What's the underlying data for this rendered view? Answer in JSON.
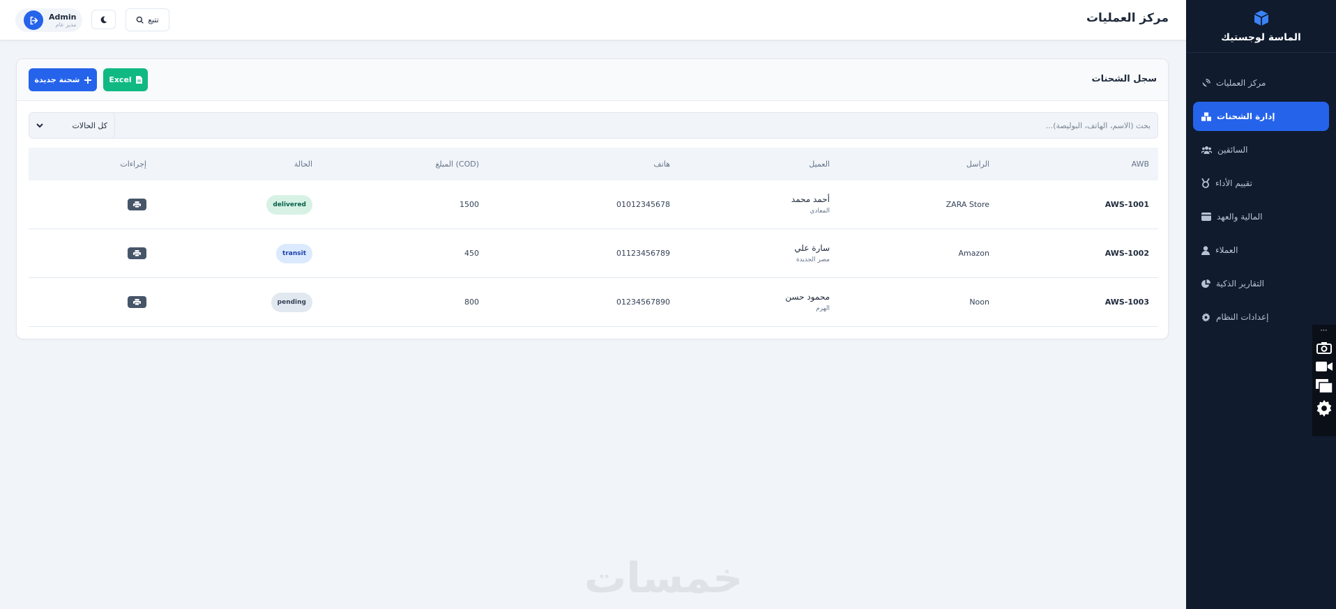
{
  "brand": {
    "name": "الماسة لوجستيك",
    "logo_icon": "cube-icon",
    "accent": "#2563eb"
  },
  "sidebar": {
    "items": [
      {
        "label": "مركز العمليات",
        "icon": "satellite-dish-icon",
        "active": false
      },
      {
        "label": "إدارة الشحنات",
        "icon": "boxes-icon",
        "active": true
      },
      {
        "label": "السائقين",
        "icon": "users-icon",
        "active": false
      },
      {
        "label": "تقييم الأداء",
        "icon": "medal-icon",
        "active": false
      },
      {
        "label": "المالية والعهد",
        "icon": "wallet-icon",
        "active": false
      },
      {
        "label": "العملاء",
        "icon": "user-icon",
        "active": false
      },
      {
        "label": "التقارير الذكية",
        "icon": "pie-chart-icon",
        "active": false
      },
      {
        "label": "إعدادات النظام",
        "icon": "gear-icon",
        "active": false
      }
    ]
  },
  "header": {
    "title": "مركز العمليات",
    "track_label": "تتبع",
    "user": {
      "name": "Admin",
      "role": "مدير عام"
    }
  },
  "card": {
    "title": "سجل الشحنات",
    "new_shipment_label": "شحنة جديدة",
    "excel_label": "Excel",
    "search_placeholder": "بحث (الاسم، الهاتف، البوليصة)...",
    "status_filter": "كل الحالات"
  },
  "table": {
    "headers": {
      "awb": "AWB",
      "sender": "الراسل",
      "client": "العميل",
      "phone": "هاتف",
      "amount": "المبلغ (COD)",
      "status": "الحالة",
      "actions": "إجراءات"
    },
    "rows": [
      {
        "awb": "AWS-1001",
        "sender": "ZARA Store",
        "client_name": "أحمد محمد",
        "client_area": "المعادي",
        "phone": "01012345678",
        "amount": "1500",
        "status": "delivered"
      },
      {
        "awb": "AWS-1002",
        "sender": "Amazon",
        "client_name": "سارة علي",
        "client_area": "مصر الجديدة",
        "phone": "01123456789",
        "amount": "450",
        "status": "transit"
      },
      {
        "awb": "AWS-1003",
        "sender": "Noon",
        "client_name": "محمود حسن",
        "client_area": "الهرم",
        "phone": "01234567890",
        "amount": "800",
        "status": "pending"
      }
    ]
  },
  "status_colors": {
    "delivered": "#d7f2e5",
    "transit": "#dbeafe",
    "pending": "#e2e8f0"
  },
  "watermark": "خمسات"
}
